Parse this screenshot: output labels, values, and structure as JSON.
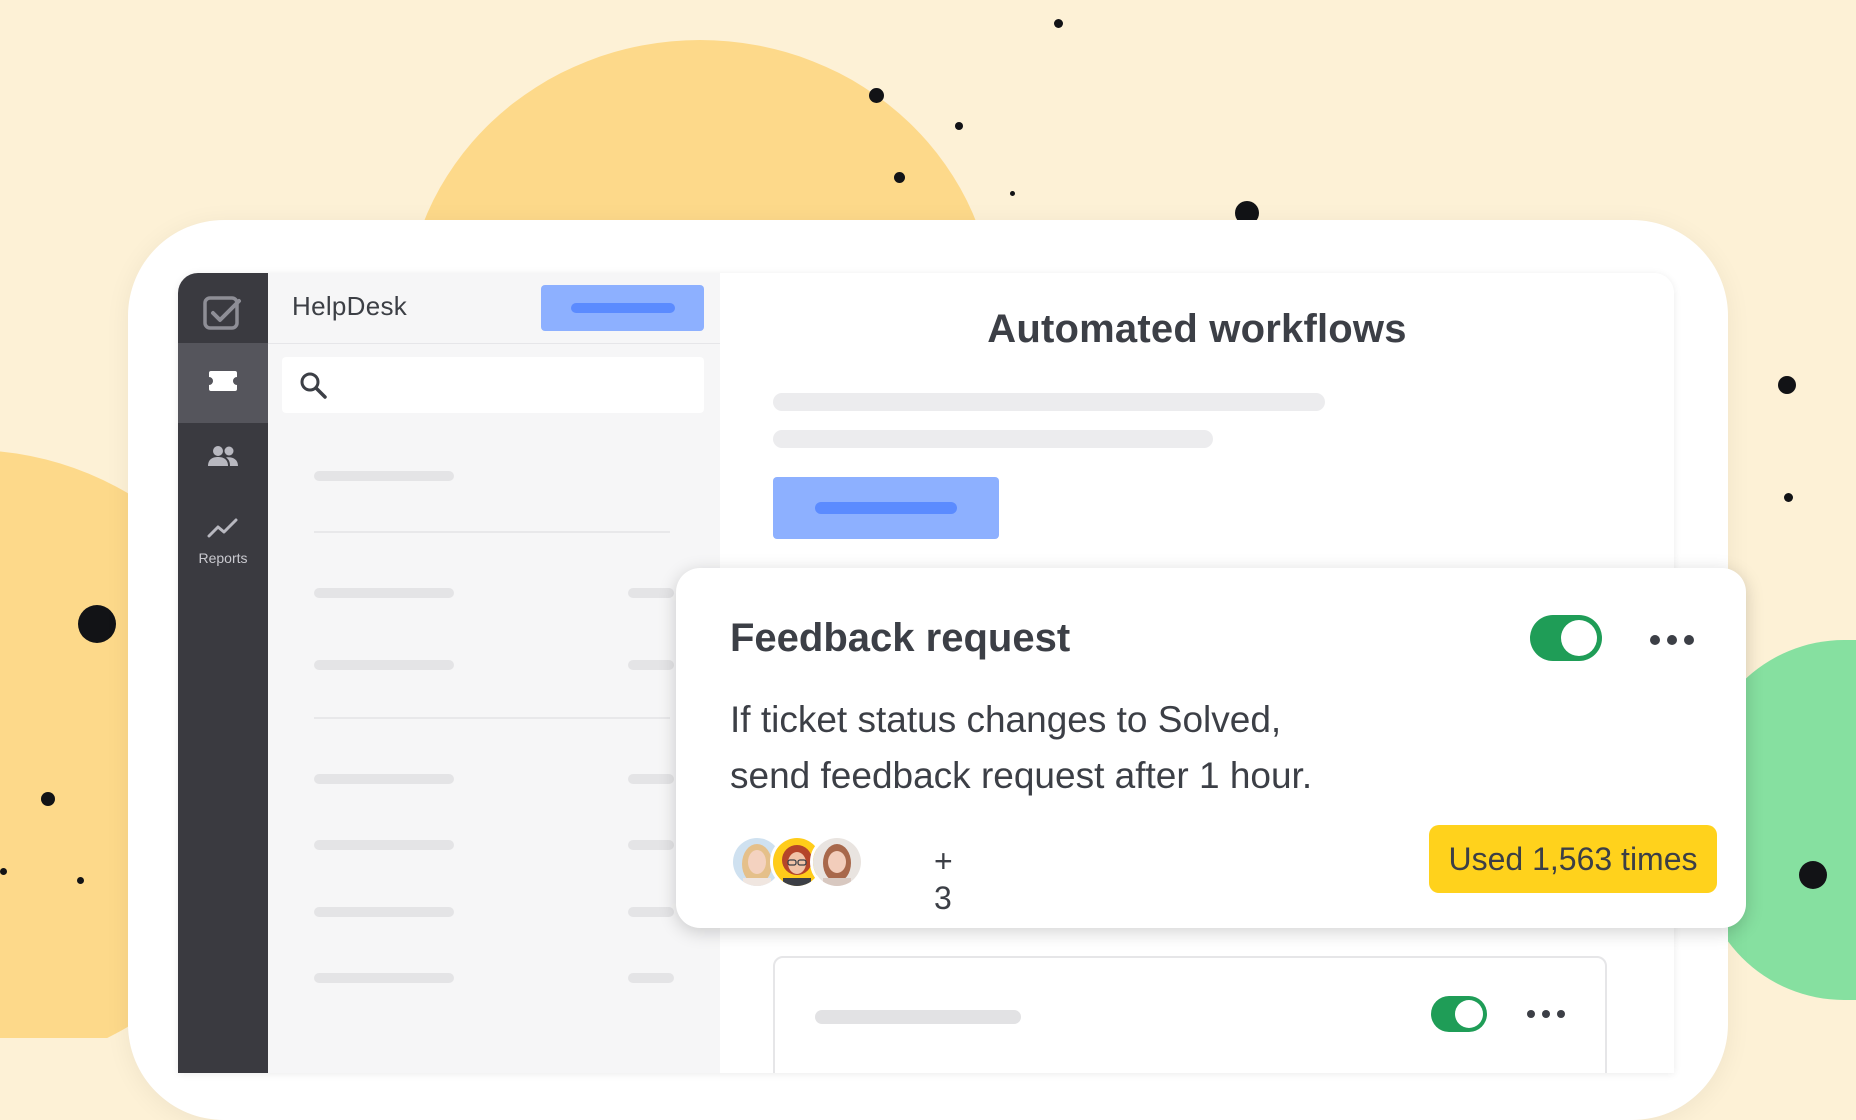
{
  "app": {
    "name": "HelpDesk"
  },
  "rail": {
    "items": [
      {
        "name": "tickets",
        "icon": "ticket-icon",
        "active": true
      },
      {
        "name": "customers",
        "icon": "people-icon",
        "active": false
      },
      {
        "name": "reports",
        "icon": "trend-chart-icon",
        "label": "Reports",
        "active": false
      }
    ]
  },
  "search": {
    "icon": "search-icon",
    "placeholder": ""
  },
  "main": {
    "title": "Automated workflows"
  },
  "workflow_card": {
    "title": "Feedback request",
    "description_line1": "If ticket status changes to Solved,",
    "description_line2": "send feedback request after 1 hour.",
    "enabled": true,
    "extra_users": "+ 3",
    "usage_badge": "Used 1,563 times",
    "avatar_count": 3
  },
  "second_workflow": {
    "enabled": true
  },
  "colors": {
    "background": "#fdf1d6",
    "accent_blue": "#8db0ff",
    "toggle_green": "#1f9d57",
    "badge_yellow": "#ffd21c",
    "rail_dark": "#3a3a40"
  }
}
